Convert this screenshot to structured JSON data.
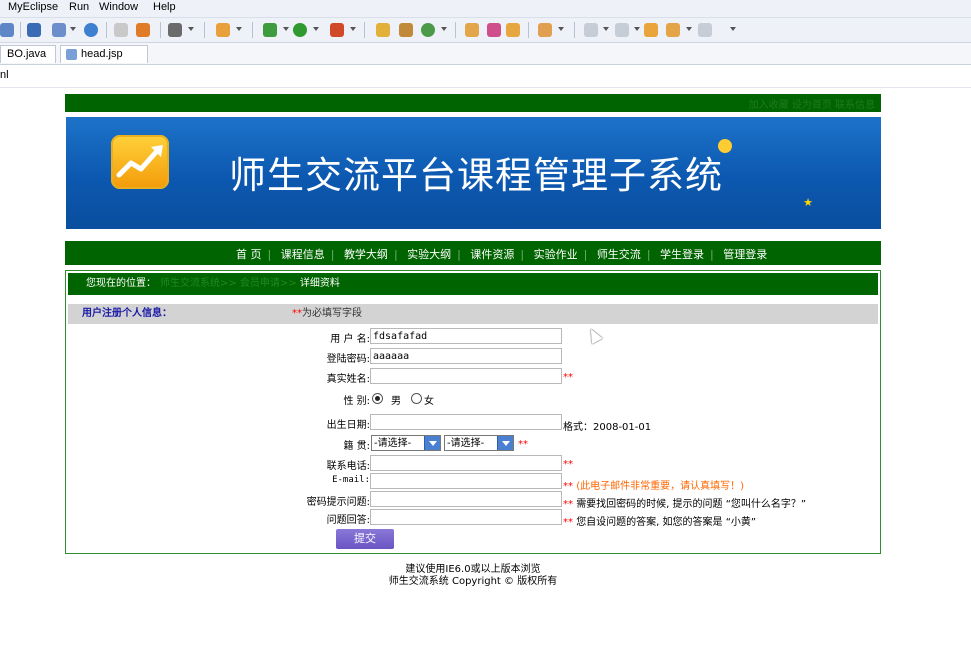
{
  "ide": {
    "menu": [
      "MyEclipse",
      "Run",
      "Window",
      "Help"
    ],
    "tabs": [
      "BO.java",
      "head.jsp"
    ],
    "address": "nl"
  },
  "site": {
    "top_links": "加入收藏  设为首页  联系信息",
    "banner_title": "师生交流平台课程管理子系统",
    "nav": [
      "首 页",
      "课程信息",
      "教学大纲",
      "实验大纲",
      "课件资源",
      "实验作业",
      "师生交流",
      "学生登录",
      "管理登录"
    ],
    "location": {
      "label": "您现在的位置：",
      "path": "师生交流系统>>  会员申请>>",
      "current": "详细资料"
    },
    "form": {
      "heading": "用户注册个人信息：",
      "required_mark": "**",
      "required_text": "为必填写字段",
      "fields": {
        "username": {
          "label": "用 户 名:",
          "value": "fdsafafad"
        },
        "password": {
          "label": "登陆密码:",
          "value": "aaaaaa"
        },
        "realname": {
          "label": "真实姓名:",
          "value": "",
          "note": "**"
        },
        "gender": {
          "label": "性   别:",
          "male": "男",
          "female": "女",
          "selected": "男"
        },
        "birthday": {
          "label": "出生日期:",
          "value": "",
          "note": "格式：2008-01-01"
        },
        "origin": {
          "label": "籍   贯:",
          "select1": "-请选择-",
          "select2": "-请选择-",
          "note": "**"
        },
        "phone": {
          "label": "联系电话:",
          "value": "",
          "note": "**"
        },
        "email": {
          "label": "E-mail:",
          "value": "",
          "note_mark": "**",
          "note": "(此电子邮件非常重要，请认真填写！)"
        },
        "question": {
          "label": "密码提示问题:",
          "value": "",
          "note_mark": "**",
          "note": "需要找回密码的时候, 提示的问题 “您叫什么名字？”"
        },
        "answer": {
          "label": "问题回答:",
          "value": "",
          "note_mark": "**",
          "note": "您自设问题的答案, 如您的答案是 “小黄”"
        }
      },
      "submit": "提交"
    },
    "footer": {
      "line1": "建议使用IE6.0或以上版本浏览",
      "line2": "师生交流系统 Copyright © 版权所有"
    }
  }
}
